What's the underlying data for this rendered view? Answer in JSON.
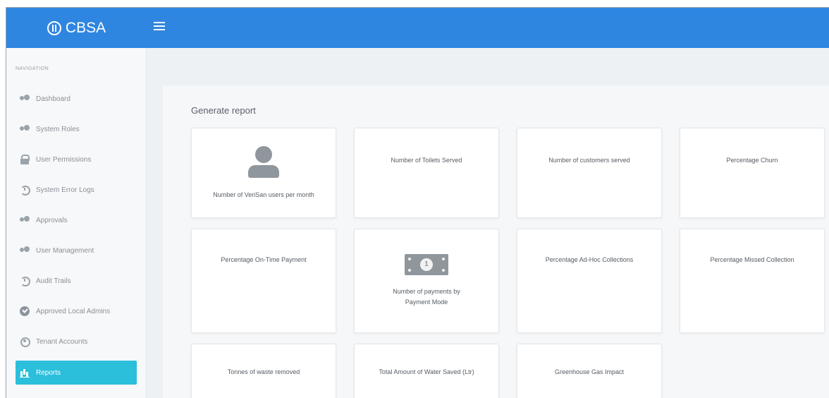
{
  "brand": {
    "name": "CBSA"
  },
  "sidebar": {
    "heading": "NAVIGATION",
    "items": [
      {
        "label": "Dashboard"
      },
      {
        "label": "System Roles"
      },
      {
        "label": "User Permissions"
      },
      {
        "label": "System Error Logs"
      },
      {
        "label": "Approvals"
      },
      {
        "label": "User Management"
      },
      {
        "label": "Audit Trails"
      },
      {
        "label": "Approved Local Admins"
      },
      {
        "label": "Tenant Accounts"
      },
      {
        "label": "Reports",
        "active": true
      }
    ]
  },
  "main": {
    "title": "Generate report",
    "cards": [
      {
        "label": "Number of VeriSan users per month",
        "icon": "user-icon"
      },
      {
        "label": "Number of Toilets Served"
      },
      {
        "label": "Number of customers served"
      },
      {
        "label": "Percentage Churn"
      },
      {
        "label": "Percentage On-Time Payment"
      },
      {
        "label": "Number of payments by Payment Mode",
        "icon": "money-icon"
      },
      {
        "label": "Percentage Ad-Hoc Collections"
      },
      {
        "label": "Percentage Missed Collection"
      },
      {
        "label": "Tonnes of waste removed"
      },
      {
        "label": "Total Amount of Water Saved (Ltr)"
      },
      {
        "label": "Greenhouse Gas Impact"
      }
    ]
  },
  "colors": {
    "topbar": "#2f86e0",
    "active_nav": "#2bbfdc",
    "sidebar_bg": "#f7f8f9",
    "content_bg": "#eef1f4"
  }
}
